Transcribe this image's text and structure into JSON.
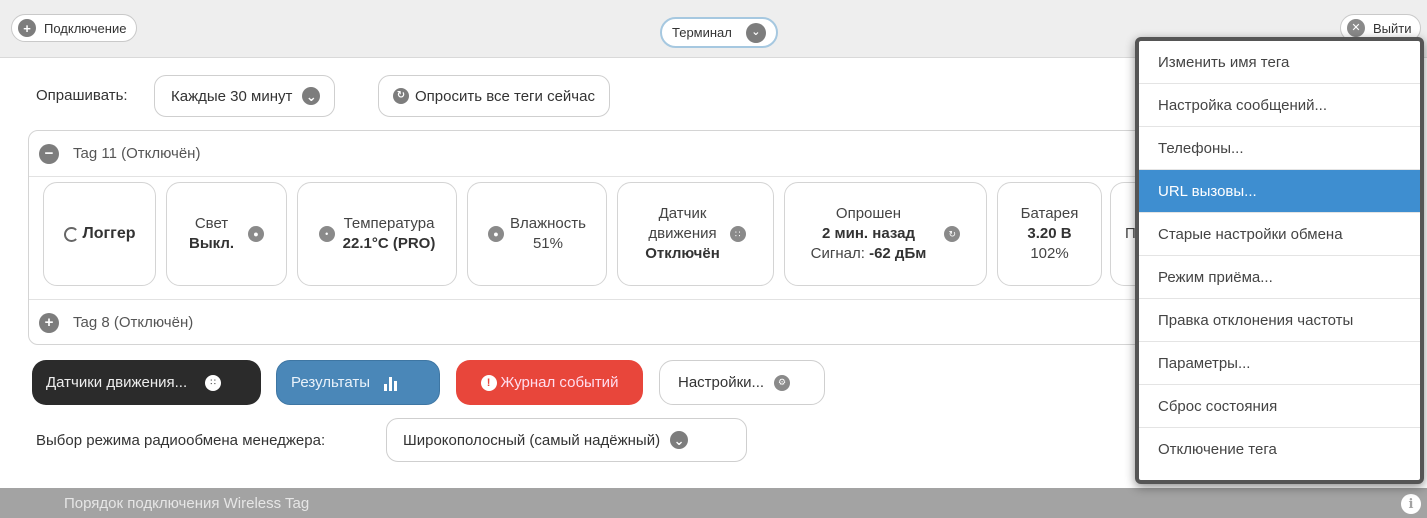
{
  "topbar": {
    "connect_label": "Подключение",
    "terminal_label": "Терминал",
    "exit_label": "Выйти"
  },
  "poll": {
    "label": "Опрашивать:",
    "interval": "Каждые 30 минут",
    "poll_all": "Опросить все теги сейчас"
  },
  "tags": [
    {
      "header": "Tag 11 (Отключён)"
    },
    {
      "header": "Tag 8 (Отключён)"
    }
  ],
  "cards": {
    "logger": "Логгер",
    "light": {
      "title": "Свет",
      "value": "Выкл."
    },
    "temperature": {
      "title": "Температура",
      "value": "22.1°C (PRO)"
    },
    "humidity": {
      "title": "Влажность",
      "value": "51%"
    },
    "motion": {
      "line1": "Датчик",
      "line2": "движения",
      "value": "Отключён"
    },
    "polled": {
      "title": "Опрошен",
      "value": "2 мин. назад",
      "signal_label": "Сигнал:",
      "signal_value": "-62 дБм"
    },
    "battery": {
      "title": "Батарея",
      "voltage": "3.20 В",
      "percent": "102%"
    },
    "more_initial": "П"
  },
  "actions": {
    "motion_sensors": "Датчики движения...",
    "results": "Результаты",
    "event_log": "Журнал событий",
    "settings": "Настройки..."
  },
  "radio": {
    "label": "Выбор режима радиообмена менеджера:",
    "value": "Широкополосный (самый надёжный)"
  },
  "footer": {
    "text": "Порядок подключения Wireless Tag"
  },
  "menu": {
    "items": [
      "Изменить имя тега",
      "Настройка сообщений...",
      "Телефоны...",
      "URL вызовы...",
      "Старые настройки обмена",
      "Режим приёма...",
      "Правка отклонения частоты",
      "Параметры...",
      "Сброс состояния",
      "Отключение тега"
    ],
    "active_index": 3
  },
  "colors": {
    "accent": "#3e8ed0",
    "results_button": "#4a87b8",
    "event_log_button": "#e8463b",
    "motion_button": "#2b2b2b",
    "footer": "#a3a3a3"
  }
}
